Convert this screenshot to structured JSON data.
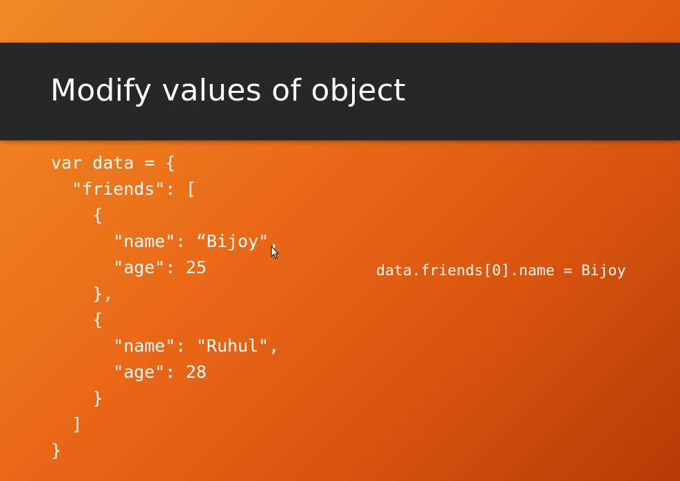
{
  "slide": {
    "title": "Modify values of object",
    "code_lines": [
      "var data = {",
      "  \"friends\": [",
      "    {",
      "      \"name\": “Bijoy\",",
      "      \"age\": 25",
      "    },",
      "    {",
      "      \"name\": \"Ruhul\",",
      "      \"age\": 28",
      "    }",
      "  ]",
      "}"
    ],
    "side_note": "data.friends[0].name = Bijoy"
  },
  "colors": {
    "background_start": "#f08a24",
    "background_end": "#b63a06",
    "title_band": "#272727",
    "text": "#ffffff"
  },
  "icons": {
    "pointer": "mouse-cursor-arrow"
  }
}
